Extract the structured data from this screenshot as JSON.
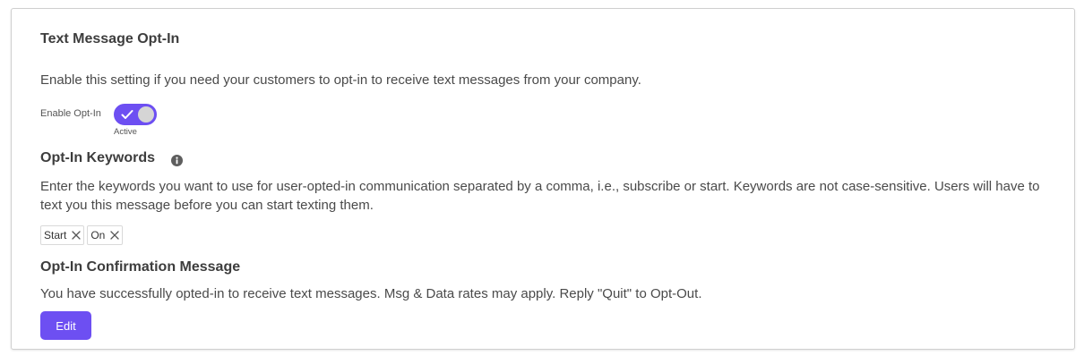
{
  "section": {
    "title": "Text Message Opt-In",
    "description": "Enable this setting if you need your customers to opt-in to receive text messages from your company."
  },
  "toggle": {
    "label": "Enable Opt-In",
    "status": "Active",
    "checked": true,
    "color": "#6d4ff2"
  },
  "keywords": {
    "title": "Opt-In Keywords",
    "icon": "info-icon",
    "description": "Enter the keywords you want to use for user-opted-in communication separated by a comma, i.e., subscribe or start. Keywords are not case-sensitive. Users will have to text you this message before you can start texting them.",
    "tags": [
      "Start",
      "On"
    ]
  },
  "confirmation": {
    "title": "Opt-In Confirmation Message",
    "message": "You have successfully opted-in to receive text messages. Msg & Data rates may apply. Reply \"Quit\" to Opt-Out.",
    "edit_label": "Edit"
  }
}
